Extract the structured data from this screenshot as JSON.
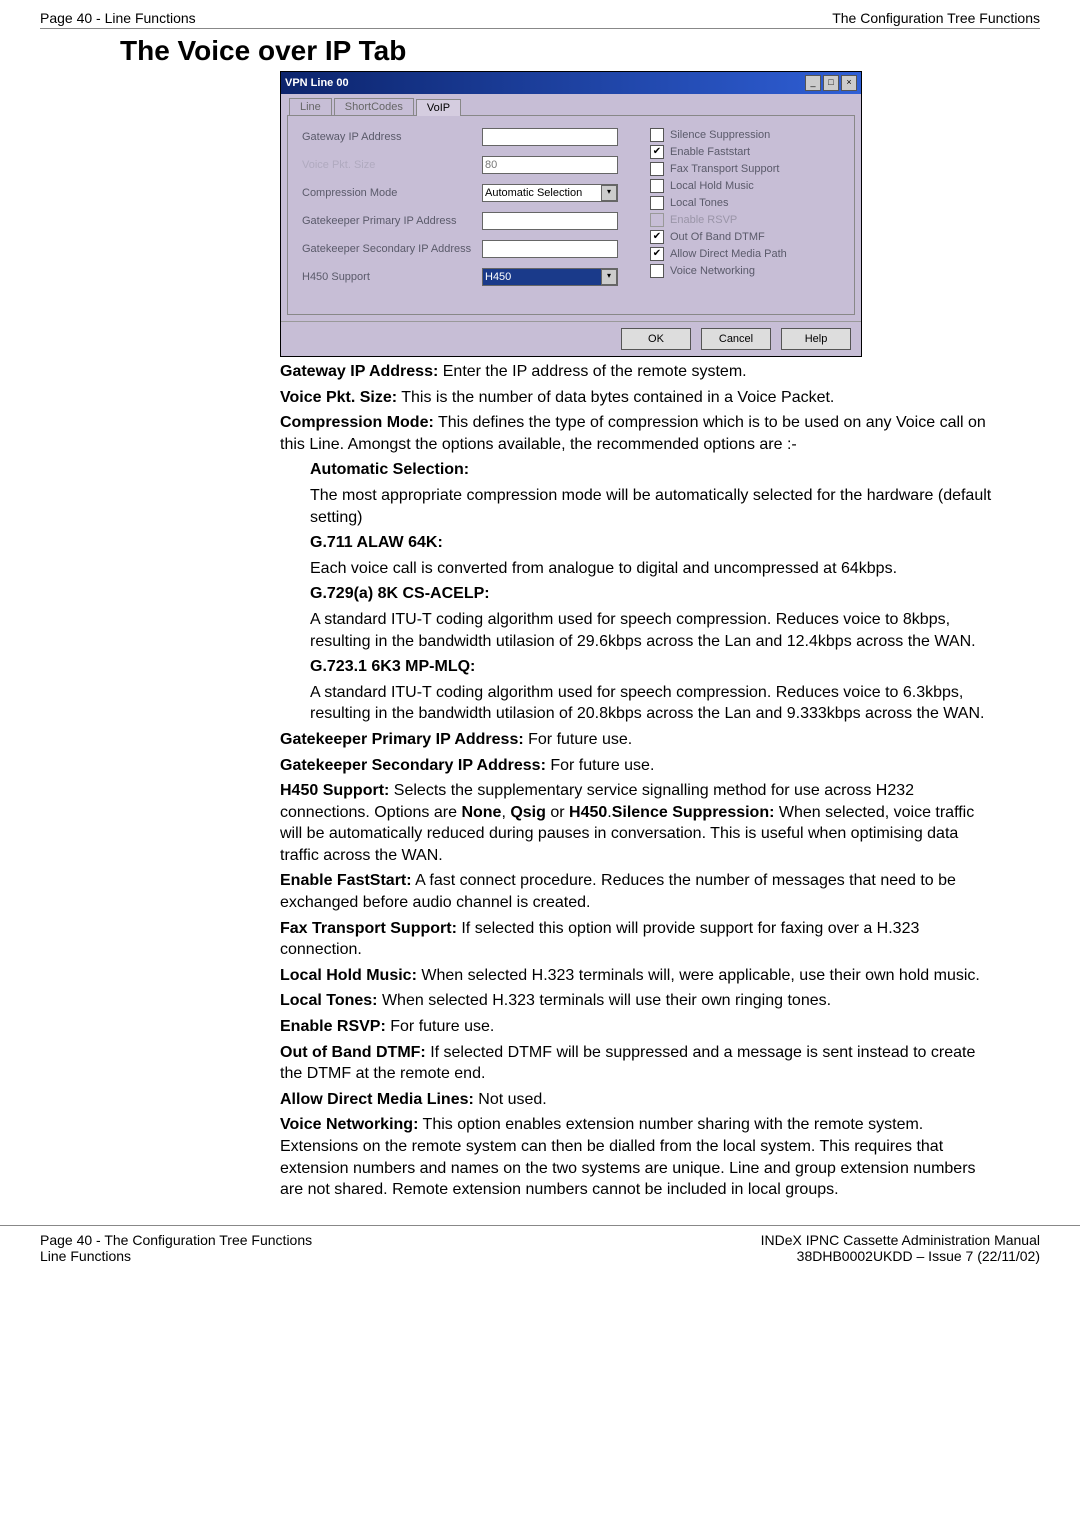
{
  "header": {
    "left": "Page 40 - Line Functions",
    "right": "The Configuration Tree Functions"
  },
  "section_title": "The Voice over IP Tab",
  "dialog": {
    "title": "VPN Line 00",
    "tabs": {
      "line": "Line",
      "shortcodes": "ShortCodes",
      "voip": "VoIP"
    },
    "labels": {
      "gateway": "Gateway IP Address",
      "voice_pkt": "Voice Pkt. Size",
      "compression": "Compression Mode",
      "gk_primary": "Gatekeeper Primary IP Address",
      "gk_secondary": "Gatekeeper Secondary IP Address",
      "h450": "H450 Support"
    },
    "values": {
      "voice_pkt": "80",
      "compression": "Automatic Selection",
      "h450": "H450"
    },
    "checks": {
      "silence": "Silence Suppression",
      "faststart": "Enable Faststart",
      "fax": "Fax Transport Support",
      "localhold": "Local Hold Music",
      "localtones": "Local Tones",
      "rsvp": "Enable RSVP",
      "oob_dtmf": "Out Of Band DTMF",
      "allow_media": "Allow Direct Media Path",
      "voice_net": "Voice Networking"
    },
    "buttons": {
      "ok": "OK",
      "cancel": "Cancel",
      "help": "Help"
    }
  },
  "text": {
    "p1a": "Gateway IP Address:",
    "p1b": " Enter the IP address of the remote system.",
    "p2a": "Voice Pkt. Size:",
    "p2b": " This is the number of data bytes contained in a Voice Packet.",
    "p3a": "Compression Mode:",
    "p3b": " This defines the type of compression which is to be used on any Voice call on this Line. Amongst the options available, the recommended options are :-",
    "auto_h": "Automatic Selection:",
    "auto_b": "The most appropriate compression mode will be automatically selected for the hardware (default setting)",
    "g711_h": "G.711 ALAW 64K:",
    "g711_b": "Each voice call is converted from analogue to digital and uncompressed at 64kbps.",
    "g729_h": "G.729(a) 8K CS-ACELP:",
    "g729_b": "A standard ITU-T coding algorithm used for speech compression. Reduces voice to 8kbps, resulting in the bandwidth utilasion of 29.6kbps across the Lan and 12.4kbps across the WAN.",
    "g723_h": "G.723.1 6K3 MP-MLQ:",
    "g723_b": "A standard ITU-T coding algorithm used for speech compression. Reduces voice to 6.3kbps, resulting in the bandwidth utilasion of 20.8kbps across the Lan and 9.333kbps across the WAN.",
    "gk_prim_a": "Gatekeeper Primary IP Address:",
    "gk_prim_b": " For future use.",
    "gk_sec_a": "Gatekeeper Secondary IP Address:",
    "gk_sec_b": " For future use.",
    "h450_a": "H450 Support:",
    "h450_b": " Selects the supplementary service signalling method for use across H232 connections. Options are ",
    "h450_none": "None",
    "h450_mid1": ", ",
    "h450_qsig": "Qsig",
    "h450_mid2": " or ",
    "h450_h450": "H450",
    "h450_dot": ".",
    "sil_a": "Silence Suppression:",
    "sil_b": " When selected, voice traffic will be automatically reduced during pauses in conversation. This is useful when optimising data traffic across the WAN.",
    "fast_a": "Enable FastStart:",
    "fast_b": " A fast connect procedure. Reduces the number of messages that need to be exchanged before audio channel is created.",
    "fax_a": "Fax Transport Support:",
    "fax_b": " If selected this option will provide support for faxing over a H.323 connection.",
    "lhm_a": "Local Hold Music:",
    "lhm_b": " When selected H.323 terminals will, were applicable,  use their own hold music.",
    "lt_a": "Local Tones:",
    "lt_b": " When selected H.323 terminals will use their own ringing tones.",
    "rsvp_a": "Enable RSVP:",
    "rsvp_b": " For future use.",
    "oob_a": "Out of Band DTMF:",
    "oob_b": " If selected DTMF will be suppressed and a message is sent instead to create the DTMF at the remote end.",
    "adm_a": "Allow Direct Media Lines:",
    "adm_b": " Not used.",
    "vn_a": "Voice Networking:",
    "vn_b": " This option enables extension number sharing with the remote system. Extensions on the remote system can then be dialled from the local system. This requires that extension numbers and names on the two systems are unique. Line and group extension numbers are not shared. Remote extension numbers cannot be included in local groups."
  },
  "footer": {
    "left1": "Page 40 - The Configuration Tree Functions",
    "left2": "Line Functions",
    "right1": "INDeX IPNC Cassette Administration Manual",
    "right2": "38DHB0002UKDD – Issue 7 (22/11/02)"
  }
}
